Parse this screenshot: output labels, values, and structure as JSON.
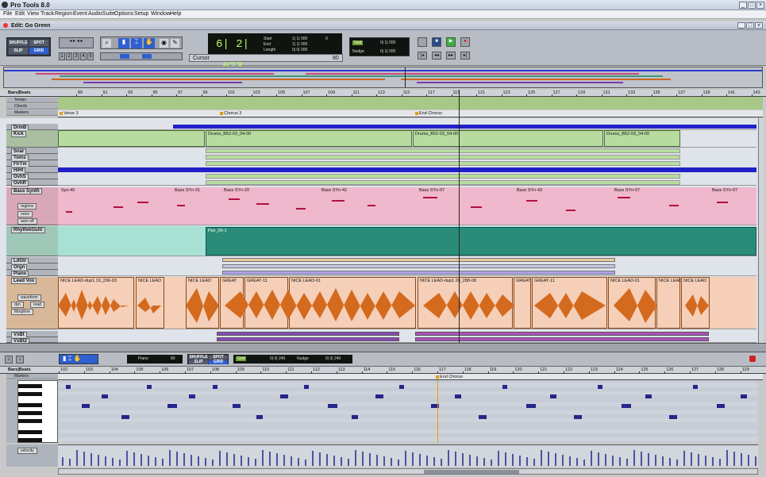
{
  "app": {
    "title": "Pro Tools 8.0",
    "window_buttons": [
      "_",
      "□",
      "×"
    ]
  },
  "menu": [
    "File",
    "Edit",
    "View",
    "Track",
    "Region",
    "Event",
    "AudioSuite",
    "Options",
    "Setup",
    "Window",
    "Help"
  ],
  "edit_window": {
    "title": "Edit: Go Green"
  },
  "toolbar": {
    "modes": [
      "SHUFFLE",
      "SPOT",
      "SLIP",
      "GRID"
    ],
    "zoom_presets": [
      "1",
      "2",
      "3",
      "4",
      "5"
    ],
    "counter": "6| 2| 623",
    "start_label": "Start",
    "end_label": "End",
    "length_label": "Length",
    "start_value": "1| 1| 000",
    "end_value": "1| 1| 000",
    "length_value": "0| 0| 000",
    "cursor_label": "Cursor",
    "grid_label": "Grid",
    "grid_value": "0| 1| 000",
    "nudge_label": "Nudge",
    "nudge_value": "0| 1| 000",
    "counter_side": "0",
    "tempo_small": "80"
  },
  "ruler": {
    "label": "Bars|Beats",
    "bars": [
      "89",
      "91",
      "93",
      "95",
      "97",
      "99",
      "101",
      "103",
      "105",
      "107",
      "109",
      "111",
      "113",
      "115",
      "117",
      "119",
      "121",
      "123",
      "125",
      "127",
      "129",
      "131",
      "133",
      "135",
      "137",
      "139",
      "141",
      "143"
    ]
  },
  "rulers": [
    "Tempo",
    "Chords",
    "Markers"
  ],
  "markers": [
    {
      "label": "Verse 3"
    },
    {
      "label": "Chorus 3"
    },
    {
      "label": "End Chorus"
    }
  ],
  "tracks": [
    {
      "name": "DrmB"
    },
    {
      "name": "Kick"
    },
    {
      "name": "Snar"
    },
    {
      "name": "Toms"
    },
    {
      "name": "FlrTm"
    },
    {
      "name": "HiHt"
    },
    {
      "name": "OvhS"
    },
    {
      "name": "OvhR"
    },
    {
      "name": "Bass Synth",
      "view": "regions",
      "sub": "none",
      "automation": "auto off"
    },
    {
      "name": "RhythmGuitr"
    },
    {
      "name": "LdGtr"
    },
    {
      "name": "Orgn"
    },
    {
      "name": "Piano"
    },
    {
      "name": "Lead Vox",
      "view": "waveform",
      "sub": "dyn",
      "sub2": "read",
      "plugin": "Morphne"
    },
    {
      "name": "VxBt"
    },
    {
      "name": "VxBt2"
    }
  ],
  "regions": {
    "drums": [
      "Drums_B52-03_04-00",
      "Drums_B52-03_04-00",
      "Drums_B52-03_04-00",
      "Drums_B52-03_04-00"
    ],
    "bass": [
      "Syn-40",
      "Bass SYn-31",
      "Bass SYn-20",
      "Bass SYn-42",
      "Bass SYn-07",
      "Bass SYn-43",
      "Bass SYn-07",
      "Bass SYn-07"
    ],
    "guitar": "Pwr_06-1",
    "vox": [
      "NICE LEAD-dup1.19_296-03",
      "NICE LEAD",
      "NICE LEAD",
      "GREAT",
      "GREAT-11",
      "NICE LEAD-01",
      "NICE LEAD-dup1.20_288-08",
      "GREAT",
      "GREAT-11",
      "NICE LEAD-01",
      "NICE LEAD",
      "NICE LEAD"
    ]
  },
  "midi_editor": {
    "tempo_label": "Piano",
    "tempo_value": "80",
    "grid_value": "0| 0| 240",
    "nudge_value": "0| 0| 240",
    "ruler_label": "Bars|Beats",
    "bars": [
      "102",
      "103",
      "104",
      "105",
      "106",
      "107",
      "108",
      "109",
      "110",
      "111",
      "112",
      "113",
      "114",
      "115",
      "116",
      "117",
      "118",
      "119",
      "120",
      "121",
      "122",
      "123",
      "124",
      "125",
      "126",
      "127",
      "128",
      "129"
    ],
    "markers_label": "Markers",
    "marker": "End Chorus",
    "velocity_label": "velocity"
  },
  "colors": {
    "accent": "#2020c8",
    "bass": "#f0b8cc",
    "guitar": "#2a8c78",
    "vox": "#d46a1e",
    "drums": "#b8dca0",
    "counter": "#b7ff66"
  }
}
